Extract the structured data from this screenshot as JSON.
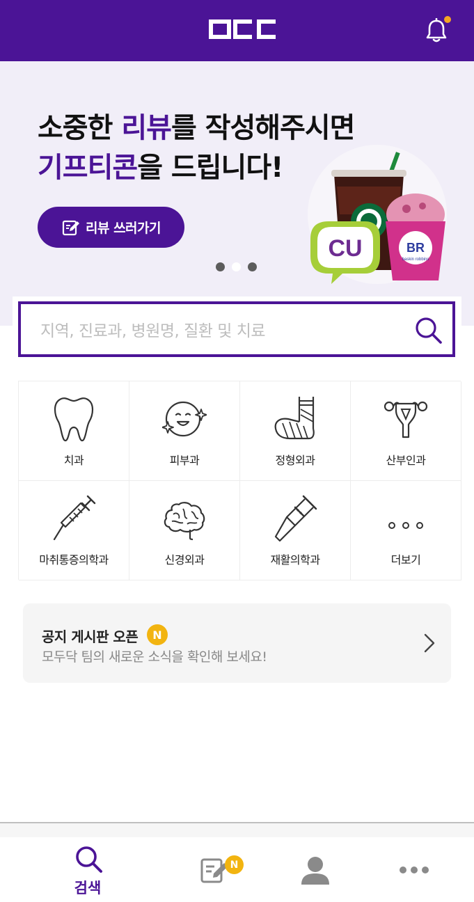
{
  "app": {
    "logo_text": "OCC",
    "brand_color": "#4b1496",
    "accent_color": "#f2b410",
    "notification_icon": "bell-icon"
  },
  "banner": {
    "headline_line1_pre": "소중한 ",
    "headline_line1_accent": "리뷰",
    "headline_line1_post": "를 작성해주시면",
    "headline_line2_accent": "기프티콘",
    "headline_line2_post": "을 드립니다!",
    "cta_label": "리뷰 쓰러가기",
    "cta_icon": "edit-icon",
    "pager_total": 3,
    "pager_active": 2,
    "promo_brands": [
      "Starbucks",
      "CU",
      "BR baskin robbins"
    ],
    "promo_text": {
      "cu": "CU",
      "br": "BR",
      "br_sub": "baskin robbins"
    }
  },
  "search": {
    "placeholder": "지역, 진료과, 병원명, 질환 및 치료",
    "icon": "search-icon"
  },
  "categories": [
    {
      "label": "치과",
      "icon": "tooth-icon"
    },
    {
      "label": "피부과",
      "icon": "face-sparkle-icon"
    },
    {
      "label": "정형외과",
      "icon": "cast-icon"
    },
    {
      "label": "산부인과",
      "icon": "uterus-icon"
    },
    {
      "label": "마취통증의학과",
      "icon": "syringe-icon"
    },
    {
      "label": "신경외과",
      "icon": "brain-icon"
    },
    {
      "label": "재활의학과",
      "icon": "crutch-icon"
    },
    {
      "label": "더보기",
      "icon": "more-dots-icon"
    }
  ],
  "notice": {
    "title": "공지 게시판 오픈",
    "badge": "N",
    "subtitle": "모두닥 팀의 새로운 소식을 확인해 보세요!",
    "icon": "chevron-right-icon"
  },
  "tabs": [
    {
      "label": "검색",
      "icon": "search-icon",
      "active": true
    },
    {
      "label": "",
      "icon": "review-edit-icon",
      "badge": "N"
    },
    {
      "label": "",
      "icon": "profile-icon"
    },
    {
      "label": "",
      "icon": "more-icon"
    }
  ]
}
